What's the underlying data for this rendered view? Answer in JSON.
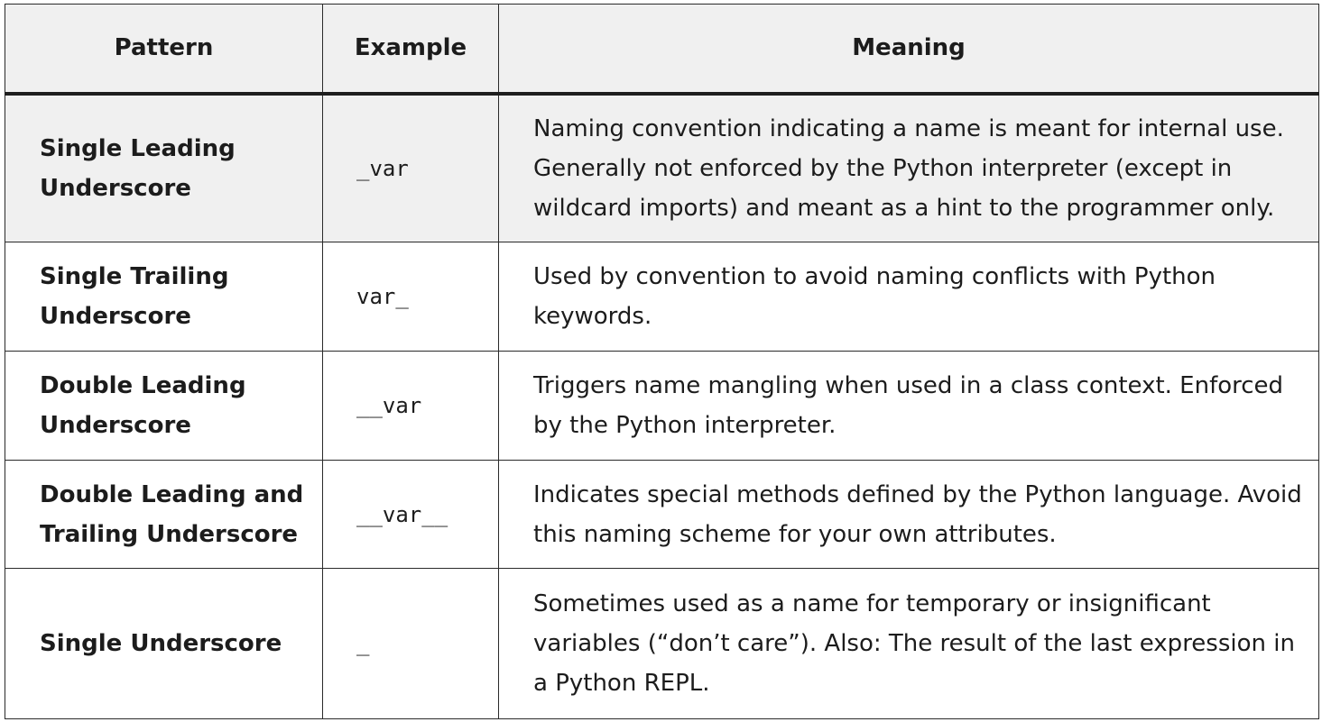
{
  "headers": {
    "pattern": "Pattern",
    "example": "Example",
    "meaning": "Meaning"
  },
  "rows": [
    {
      "pattern": "Single Leading Underscore",
      "example": "_var",
      "meaning": "Naming convention indicating a name is meant for internal use. Generally not enforced by the Python interpreter (except in wildcard imports) and meant as a hint to the programmer only."
    },
    {
      "pattern": "Single Trailing Underscore",
      "example": "var_",
      "meaning": "Used by convention to avoid naming conflicts with Python keywords."
    },
    {
      "pattern": "Double Leading Underscore",
      "example": "__var",
      "meaning": "Triggers name mangling when used in a class context. Enforced by the Python interpreter."
    },
    {
      "pattern": "Double Leading and Trailing Underscore",
      "example": "__var__",
      "meaning": "Indicates special methods defined by the Python language. Avoid this naming scheme for your own attributes."
    },
    {
      "pattern": "Single Underscore",
      "example": "_",
      "meaning": "Sometimes used as a name for temporary or insignificant variables (“don’t care”). Also: The result of the last expression in a Python REPL."
    }
  ],
  "colors": {
    "header_background": "#f0f0f0",
    "shaded_row_background": "#f0f0f0",
    "border": "#2a2a2a",
    "text": "#1c1c1c"
  }
}
